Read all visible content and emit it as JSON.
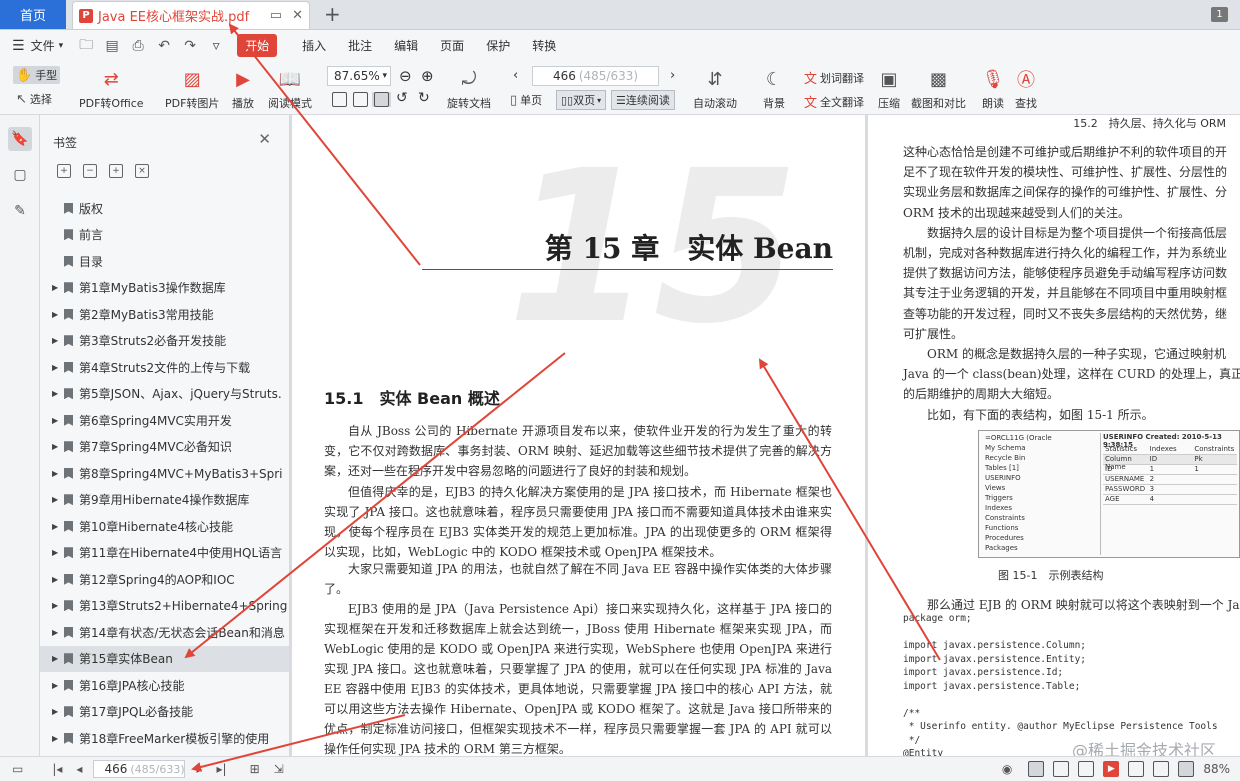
{
  "tabs": {
    "home": "首页",
    "document": "Java EE核心框架实战.pdf",
    "badge": "1"
  },
  "menubar": {
    "file": "文件",
    "start": "开始",
    "items": [
      "插入",
      "批注",
      "编辑",
      "页面",
      "保护",
      "转换"
    ]
  },
  "ribbon": {
    "hand": "手型",
    "select": "选择",
    "pdf_to_office": "PDF转Office",
    "pdf_to_image": "PDF转图片",
    "play": "播放",
    "read_mode": "阅读模式",
    "zoom": "87.65%",
    "rotate": "旋转文档",
    "page_current": "466",
    "page_total": "(485/633)",
    "single": "单页",
    "double": "双页",
    "continuous": "连续阅读",
    "autoscroll": "自动滚动",
    "background": "背景",
    "word_translate": "划词翻译",
    "full_translate": "全文翻译",
    "compress": "压缩",
    "screenshot": "截图和对比",
    "read_aloud": "朗读",
    "find": "查找"
  },
  "bookmarks": {
    "title": "书签",
    "items": [
      {
        "label": "版权",
        "expandable": false
      },
      {
        "label": "前言",
        "expandable": false
      },
      {
        "label": "目录",
        "expandable": false
      },
      {
        "label": "第1章MyBatis3操作数据库",
        "expandable": true
      },
      {
        "label": "第2章MyBatis3常用技能",
        "expandable": true
      },
      {
        "label": "第3章Struts2必备开发技能",
        "expandable": true
      },
      {
        "label": "第4章Struts2文件的上传与下载",
        "expandable": true
      },
      {
        "label": "第5章JSON、Ajax、jQuery与Struts.",
        "expandable": true
      },
      {
        "label": "第6章Spring4MVC实用开发",
        "expandable": true
      },
      {
        "label": "第7章Spring4MVC必备知识",
        "expandable": true
      },
      {
        "label": "第8章Spring4MVC+MyBatis3+Spri",
        "expandable": true
      },
      {
        "label": "第9章用Hibernate4操作数据库",
        "expandable": true
      },
      {
        "label": "第10章Hibernate4核心技能",
        "expandable": true
      },
      {
        "label": "第11章在Hibernate4中使用HQL语言",
        "expandable": true
      },
      {
        "label": "第12章Spring4的AOP和IOC",
        "expandable": true
      },
      {
        "label": "第13章Struts2+Hibernate4+Spring",
        "expandable": true
      },
      {
        "label": "第14章有状态/无状态会话Bean和消息",
        "expandable": true
      },
      {
        "label": "第15章实体Bean",
        "expandable": true,
        "selected": true
      },
      {
        "label": "第16章JPA核心技能",
        "expandable": true
      },
      {
        "label": "第17章JPQL必备技能",
        "expandable": true
      },
      {
        "label": "第18章FreeMarker模板引擎的使用",
        "expandable": true
      }
    ]
  },
  "page_left": {
    "chapter_title": "第 15 章　实体 Bean",
    "chapter_number_watermark": "15",
    "section_title": "15.1　实体 Bean 概述",
    "paragraphs": [
      "自从 JBoss 公司的 Hibernate 开源项目发布以来，使软件业开发的行为发生了重大的转变，它不仅对跨数据库、事务封装、ORM 映射、延迟加载等这些细节技术提供了完善的解决方案，还对一些在程序开发中容易忽略的问题进行了良好的封装和规划。",
      "但值得庆幸的是，EJB3 的持久化解决方案使用的是 JPA 接口技术，而 Hibernate 框架也实现了 JPA 接口。这也就意味着，程序员只需要使用 JPA 接口而不需要知道具体技术由谁来实现，使每个程序员在 EJB3 实体类开发的规范上更加标准。JPA 的出现使更多的 ORM 框架得以实现，比如，WebLogic 中的 KODO 框架技术或 OpenJPA 框架技术。",
      "大家只需要知道 JPA 的用法，也就自然了解在不同 Java EE 容器中操作实体类的大体步骤了。",
      "EJB3 使用的是 JPA（Java Persistence Api）接口来实现持久化，这样基于 JPA 接口的实现框架在开发和迁移数据库上就会达到统一，JBoss 使用 Hibernate 框架来实现 JPA，而 WebLogic 使用的是 KODO 或 OpenJPA 来进行实现，WebSphere 也使用 OpenJPA 来进行实现 JPA 接口。这也就意味着，只要掌握了 JPA 的使用，就可以在任何实现 JPA 标准的 Java EE 容器中使用 EJB3 的实体技术，更具体地说，只需要掌握 JPA 接口中的核心 API 方法，就可以用这些方法去操作 Hibernate、OpenJPA 或 KODO 框架了。这就是 Java 接口所带来的优点，制定标准访问接口，但框架实现技术不一样，程序员只需要掌握一套 JPA 的 API 就可以操作任何实现 JPA 技术的 ORM 第三方框架。"
    ]
  },
  "page_right": {
    "header": "15.2　持久层、持久化与 ORM",
    "lines": [
      "这种心态恰恰是创建不可维护或后期维护不利的软件项目的开",
      "足不了现在软件开发的模块性、可维护性、扩展性、分层性的",
      "实现业务层和数据库之间保存的操作的可维护性、扩展性、分",
      "ORM 技术的出现越来越受到人们的关注。",
      "　　数据持久层的设计目标是为整个项目提供一个衔接高低层",
      "机制，完成对各种数据库进行持久化的编程工作，并为系统业",
      "提供了数据访问方法，能够使程序员避免手动编写程序访问数",
      "其专注于业务逻辑的开发，并且能够在不同项目中重用映射框",
      "查等功能的开发过程，同时又不丧失多层结构的天然优势，继",
      "可扩展性。",
      "　　ORM 的概念是数据持久层的一种子实现，它通过映射机",
      "Java 的一个 class(bean)处理，这样在 CURD 的处理上，真正实",
      "的后期维护的周期大大缩短。",
      "　　比如，有下面的表结构，如图 15-1 所示。"
    ],
    "figure_caption": "图 15-1　示例表结构",
    "figure_tree": [
      "=ORCL11G (Oracle",
      "My Schema",
      "Recycle Bin",
      "Tables [1]",
      "USERINFO",
      "Views",
      "Triggers",
      "Indexes",
      "Constraints",
      "Functions",
      "Procedures",
      "Packages"
    ],
    "figure_header": "USERINFO  Created: 2010-5-13 9:38:15",
    "figure_tabs": [
      "Statistics",
      "Indexes",
      "Constraints"
    ],
    "figure_columns": [
      "Column Name",
      "ID",
      "Pk"
    ],
    "figure_rows": [
      [
        "ID",
        "1",
        "1"
      ],
      [
        "USERNAME",
        "2",
        ""
      ],
      [
        "PASSWORD",
        "3",
        ""
      ],
      [
        "AGE",
        "4",
        ""
      ]
    ],
    "after_figure": "　　那么通过 EJB 的 ORM 映射就可以将这个表映射到一个 Ja",
    "code_lines": [
      "package orm;",
      "",
      "import javax.persistence.Column;",
      "import javax.persistence.Entity;",
      "import javax.persistence.Id;",
      "import javax.persistence.Table;",
      "",
      "/**",
      " * Userinfo entity. @author MyEclipse Persistence Tools",
      " */",
      "@Entity"
    ]
  },
  "watermark": "@稀土掘金技术社区",
  "statusbar": {
    "page_current": "466",
    "page_total": "(485/633)",
    "zoom": "88%"
  },
  "colors": {
    "accent": "#e0453a",
    "home_tab": "#2b6fd8",
    "arrow": "#e0453a"
  }
}
